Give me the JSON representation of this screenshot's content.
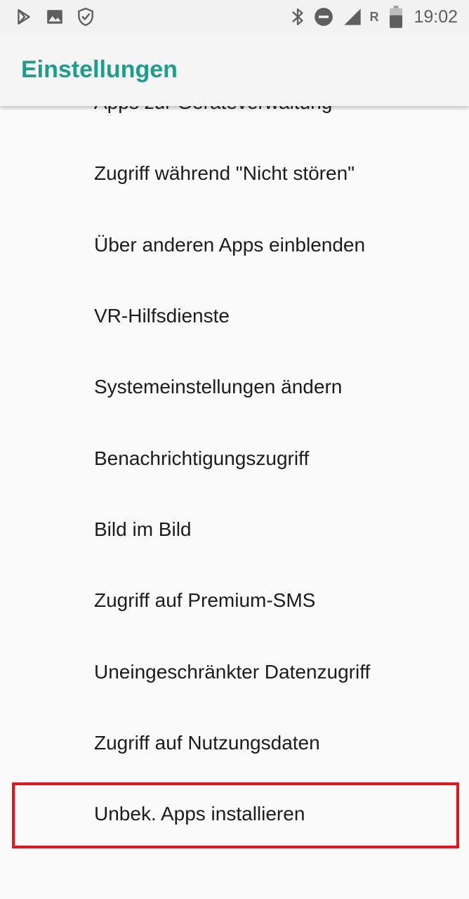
{
  "status_bar": {
    "icons_left": [
      "play-store-icon",
      "image-icon",
      "shield-check-icon"
    ],
    "icons_right": [
      "bluetooth-icon",
      "do-not-disturb-icon",
      "signal-icon",
      "battery-icon"
    ],
    "roaming_indicator": "R",
    "time": "19:02"
  },
  "app_bar": {
    "title": "Einstellungen",
    "title_color": "#1f9c8c"
  },
  "list": {
    "items": [
      {
        "label": "Apps zur Geräteverwaltung"
      },
      {
        "label": "Zugriff während \"Nicht stören\""
      },
      {
        "label": "Über anderen Apps einblenden"
      },
      {
        "label": "VR-Hilfsdienste"
      },
      {
        "label": "Systemeinstellungen ändern"
      },
      {
        "label": "Benachrichtigungszugriff"
      },
      {
        "label": "Bild im Bild"
      },
      {
        "label": "Zugriff auf Premium-SMS"
      },
      {
        "label": "Uneingeschränkter Datenzugriff"
      },
      {
        "label": "Zugriff auf Nutzungsdaten"
      },
      {
        "label": "Unbek. Apps installieren"
      }
    ]
  },
  "highlight_color": "#e8141b"
}
